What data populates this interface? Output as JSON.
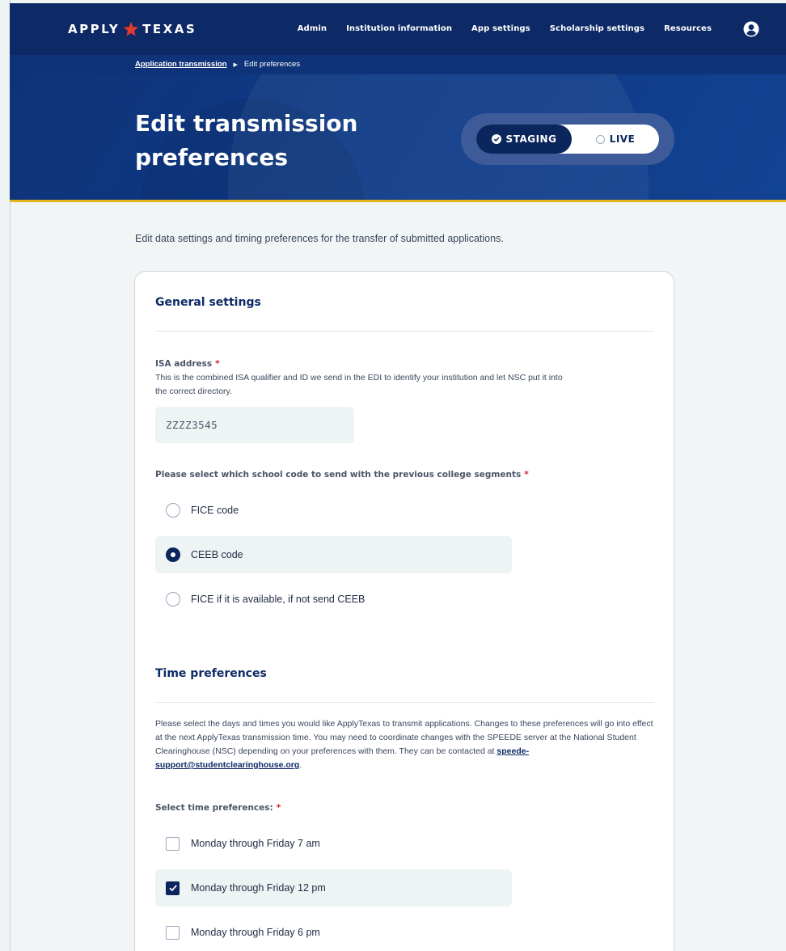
{
  "brand": {
    "word1": "APPLY",
    "word2": "TEXAS"
  },
  "nav": {
    "items": [
      {
        "label": "Admin"
      },
      {
        "label": "Institution information"
      },
      {
        "label": "App settings"
      },
      {
        "label": "Scholarship settings"
      },
      {
        "label": "Resources"
      }
    ]
  },
  "breadcrumb": {
    "parent": "Application transmission",
    "current": "Edit preferences"
  },
  "hero": {
    "title": "Edit transmission preferences",
    "toggle": {
      "staging": "STAGING",
      "live": "LIVE",
      "selected": "STAGING"
    }
  },
  "intro": "Edit data settings and timing preferences for the transfer of submitted applications.",
  "general": {
    "heading": "General settings",
    "isa": {
      "label": "ISA address",
      "required": "*",
      "help": "This is the combined ISA qualifier and ID we send in the EDI to identify your institution and let NSC put it into the correct directory.",
      "value": "ZZZZ3545"
    },
    "school_code": {
      "label": "Please select which school code to send with the previous college segments",
      "required": "*",
      "options": [
        {
          "label": "FICE code",
          "selected": false
        },
        {
          "label": "CEEB code",
          "selected": true
        },
        {
          "label": "FICE if it is available, if not send CEEB",
          "selected": false
        }
      ]
    }
  },
  "time": {
    "heading": "Time preferences",
    "help_before": "Please select the days and times you would like ApplyTexas to transmit applications. Changes to these preferences will go into effect at the next ApplyTexas transmission time. You may need to coordinate changes with the SPEEDE server at the National Student Clearinghouse (NSC) depending on your preferences with them. They can be contacted at ",
    "email": "speede-support@studentclearinghouse.org",
    "help_after": ".",
    "select_label": "Select time preferences:",
    "required": "*",
    "options": [
      {
        "label": "Monday through Friday 7 am",
        "checked": false
      },
      {
        "label": "Monday through Friday 12 pm",
        "checked": true
      },
      {
        "label": "Monday through Friday 6 pm",
        "checked": false
      }
    ]
  },
  "colors": {
    "navy": "#0d2a66",
    "accent_gold": "#e3b320",
    "required_red": "#d0202f",
    "selected_bg": "#eef3f3"
  }
}
